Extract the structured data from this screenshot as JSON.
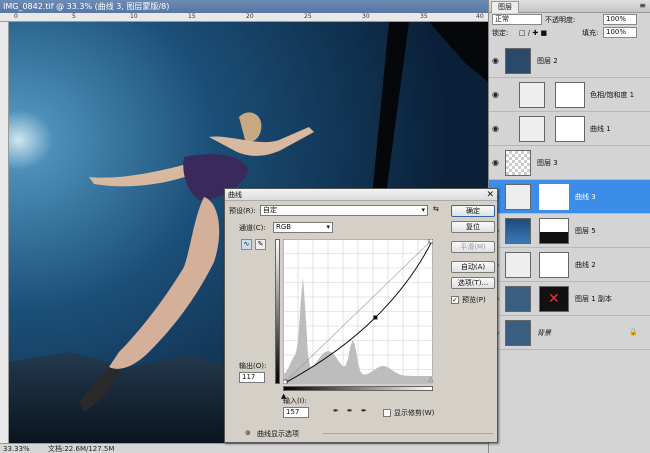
{
  "document": {
    "title": "IMG_0842.tif @ 33.3% (曲线 3, 图层蒙版/8)",
    "ruler_ticks": [
      "0",
      "5",
      "10",
      "15",
      "20",
      "25",
      "30",
      "35",
      "40"
    ],
    "status": {
      "zoom": "33.33%",
      "doc_size": "文档:22.6M/127.5M"
    }
  },
  "layers_panel": {
    "tab": "图层",
    "blend_mode": "正常",
    "opacity_label": "不透明度:",
    "opacity": "100%",
    "lock_label": "锁定:",
    "fill_label": "填充:",
    "fill": "100%",
    "layers": [
      {
        "name": "图层 2"
      },
      {
        "name": "色相/饱和度 1"
      },
      {
        "name": "曲线 1"
      },
      {
        "name": "图层 3"
      },
      {
        "name": "曲线 3"
      },
      {
        "name": "图层 5"
      },
      {
        "name": "曲线 2"
      },
      {
        "name": "图层 1 副本"
      },
      {
        "name": "背景"
      }
    ]
  },
  "curves_dialog": {
    "title": "曲线",
    "preset_label": "预设(R):",
    "preset_value": "自定",
    "channel_label": "通道(C):",
    "channel_value": "RGB",
    "output_label": "输出(O):",
    "output_value": "117",
    "input_label": "输入(I):",
    "input_value": "157",
    "show_clipping": "显示修剪(W)",
    "display_options": "曲线显示选项",
    "buttons": {
      "ok": "确定",
      "reset": "复位",
      "smooth": "平滑(M)",
      "auto": "自动(A)",
      "options": "选项(T)...",
      "preview": "预览(P)"
    },
    "curve_point": {
      "input": 157,
      "output": 117
    }
  },
  "colors": {
    "selection": "#3b8de8",
    "dialog_bg": "#d4d0c8"
  }
}
